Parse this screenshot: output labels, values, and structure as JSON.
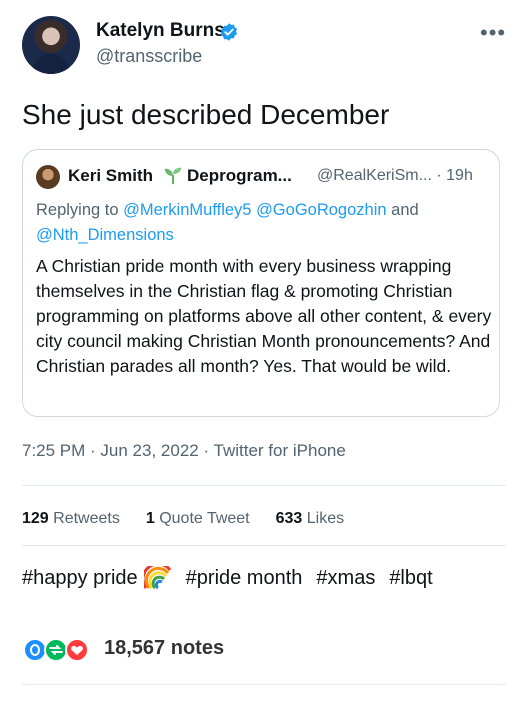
{
  "header": {
    "display_name": "Katelyn Burns",
    "handle": "@transscribe",
    "more_label": "•••"
  },
  "tweet": {
    "text": "She just described December"
  },
  "quote": {
    "name": "Keri Smith",
    "name_suffix": "Deprogram...",
    "handle_time": "@RealKeriSm... · 19h",
    "reply_prefix": "Replying to ",
    "mention_1": "@MerkinMuffley5",
    "mention_2": "@GoGoRogozhin",
    "reply_and": " and ",
    "mention_3": "@Nth_Dimensions",
    "body": "A Christian pride month with every business wrapping themselves in the Christian flag & promoting Christian programming on platforms above all other content, & every city council making Christian Month pronouncements? And Christian parades all month? Yes. That would be wild."
  },
  "meta": {
    "timestamp": "7:25 PM · Jun 23, 2022 · Twitter for iPhone"
  },
  "stats": {
    "retweets_count": "129",
    "retweets_label": " Retweets",
    "quotes_count": "1",
    "quotes_label": " Quote Tweet",
    "likes_count": "633",
    "likes_label": " Likes"
  },
  "tags": [
    "#happy pride",
    "#pride month",
    "#xmas",
    "#lbqt"
  ],
  "notes": {
    "count_label": "18,567 notes"
  },
  "colors": {
    "accent": "#1d9bf0",
    "secondary_text": "#536471",
    "note_blue": "#1d8fff",
    "note_green": "#00b85c",
    "note_red": "#ff3b3b"
  }
}
